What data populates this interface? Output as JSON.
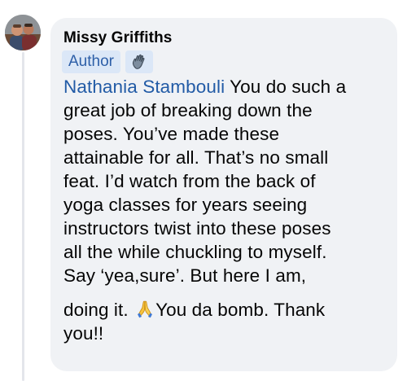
{
  "comment": {
    "author_name": "Missy Griffiths",
    "author_badge": "Author",
    "badge_icon": "waving-hand-icon",
    "mention": "Nathania Stambouli",
    "lines": [
      " You do such a",
      "great job of breaking down the",
      "poses. You’ve made these",
      "attainable for all. That’s no small",
      "feat. I’d watch from the back of",
      "yoga classes for years seeing",
      "instructors twist into these poses",
      "all the while chuckling to myself.",
      "Say ‘yea,sure’. But here I am,",
      "doing it. ",
      "You da bomb. Thank",
      "you!!"
    ],
    "emoji_icon": "folded-hands-icon"
  },
  "colors": {
    "bubble_bg": "#f0f2f5",
    "mention": "#225ba6",
    "badge_bg": "#dbe7f7",
    "badge_text": "#2d5fa8"
  }
}
